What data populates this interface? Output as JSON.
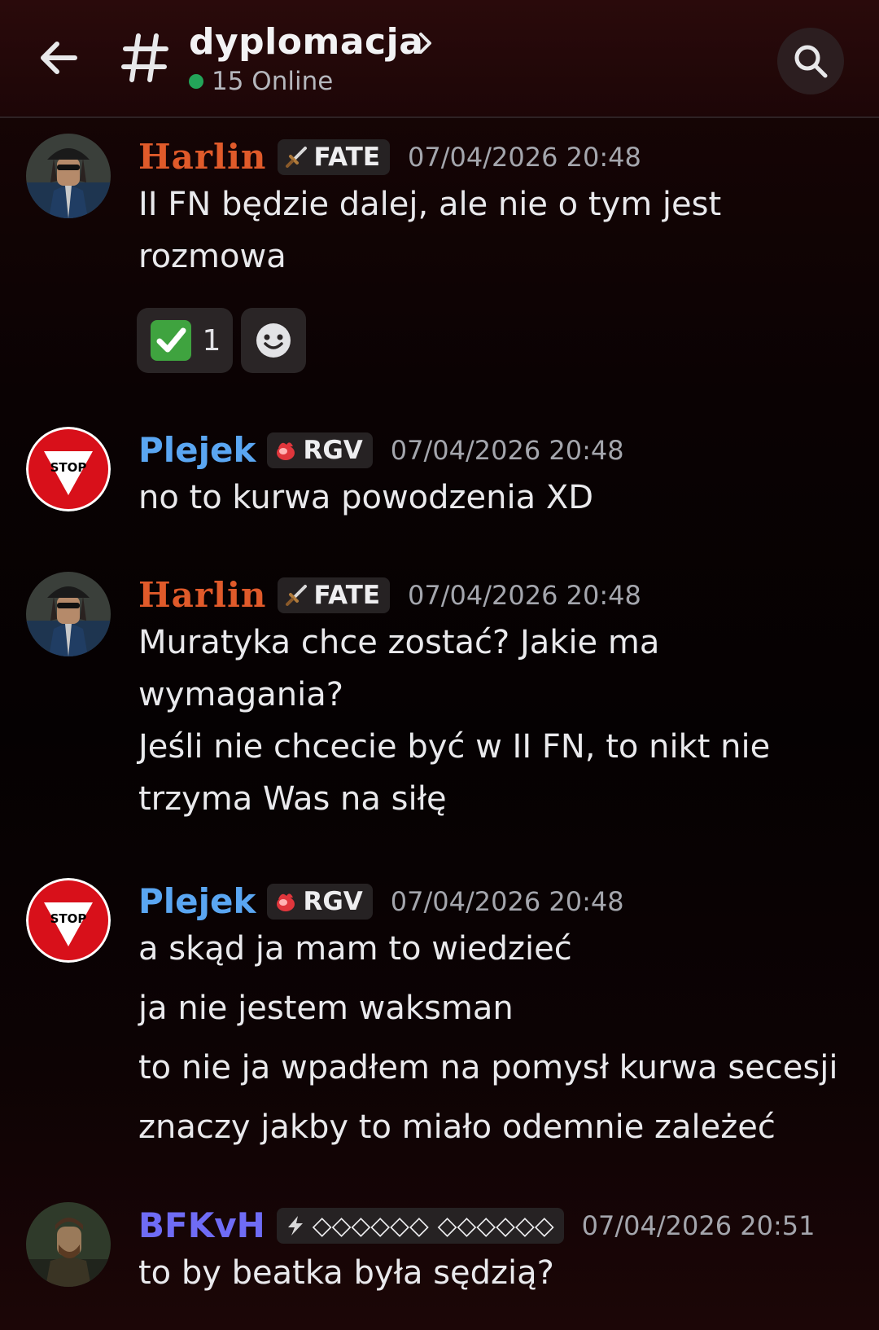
{
  "header": {
    "channel_name": "dyplomacja",
    "online_text": "15 Online",
    "back_icon": "arrow-left-icon",
    "search_icon": "search-icon"
  },
  "colors": {
    "harlin": "#e05a2a",
    "plejek": "#5aa6f2",
    "bfkvh": "#6f6cf5",
    "online": "#23a559"
  },
  "messages": [
    {
      "author": "Harlin",
      "tag": "FATE",
      "tag_icon": "sword-icon",
      "time": "07/04/2026 20:48",
      "lines": [
        "II FN będzie dalej, ale nie o tym jest",
        "rozmowa"
      ],
      "reactions": [
        {
          "emoji": "check-mark-icon",
          "count": "1"
        }
      ],
      "add_reaction_icon": "add-reaction-smiley-icon"
    },
    {
      "author": "Plejek",
      "tag": "RGV",
      "tag_icon": "flame-icon",
      "time": "07/04/2026 20:48",
      "lines": [
        "no to kurwa powodzenia XD"
      ]
    },
    {
      "author": "Harlin",
      "tag": "FATE",
      "tag_icon": "sword-icon",
      "time": "07/04/2026 20:48",
      "lines": [
        "Muratyka chce zostać? Jakie ma",
        "wymagania?",
        "Jeśli nie chcecie być w II FN, to nikt nie",
        "trzyma Was na siłę"
      ]
    },
    {
      "author": "Plejek",
      "tag": "RGV",
      "tag_icon": "flame-icon",
      "time": "07/04/2026 20:48",
      "lines": [
        "a skąd ja mam to wiedzieć",
        "ja nie jestem waksman",
        "to nie ja wpadłem na pomysł kurwa secesji",
        "znaczy jakby to miało odemnie zależeć"
      ]
    },
    {
      "author": "BFKvH",
      "tag": "◇◇◇◇◇◇ ◇◇◇◇◇◇",
      "tag_icon": "lightning-icon",
      "time": "07/04/2026 20:51",
      "lines": [
        "to by beatka była sędzią?"
      ]
    }
  ]
}
